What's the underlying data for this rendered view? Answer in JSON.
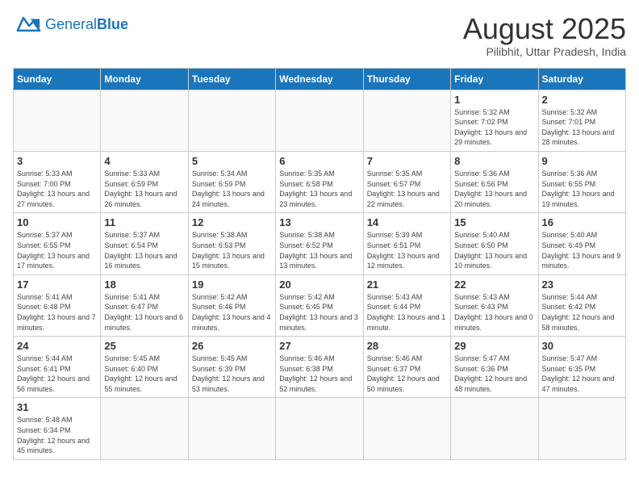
{
  "logo": {
    "text_general": "General",
    "text_blue": "Blue"
  },
  "calendar": {
    "title": "August 2025",
    "subtitle": "Pilibhit, Uttar Pradesh, India",
    "days_of_week": [
      "Sunday",
      "Monday",
      "Tuesday",
      "Wednesday",
      "Thursday",
      "Friday",
      "Saturday"
    ],
    "weeks": [
      [
        {
          "day": "",
          "info": ""
        },
        {
          "day": "",
          "info": ""
        },
        {
          "day": "",
          "info": ""
        },
        {
          "day": "",
          "info": ""
        },
        {
          "day": "",
          "info": ""
        },
        {
          "day": "1",
          "info": "Sunrise: 5:32 AM\nSunset: 7:02 PM\nDaylight: 13 hours and 29 minutes."
        },
        {
          "day": "2",
          "info": "Sunrise: 5:32 AM\nSunset: 7:01 PM\nDaylight: 13 hours and 28 minutes."
        }
      ],
      [
        {
          "day": "3",
          "info": "Sunrise: 5:33 AM\nSunset: 7:00 PM\nDaylight: 13 hours and 27 minutes."
        },
        {
          "day": "4",
          "info": "Sunrise: 5:33 AM\nSunset: 6:59 PM\nDaylight: 13 hours and 26 minutes."
        },
        {
          "day": "5",
          "info": "Sunrise: 5:34 AM\nSunset: 6:59 PM\nDaylight: 13 hours and 24 minutes."
        },
        {
          "day": "6",
          "info": "Sunrise: 5:35 AM\nSunset: 6:58 PM\nDaylight: 13 hours and 23 minutes."
        },
        {
          "day": "7",
          "info": "Sunrise: 5:35 AM\nSunset: 6:57 PM\nDaylight: 13 hours and 22 minutes."
        },
        {
          "day": "8",
          "info": "Sunrise: 5:36 AM\nSunset: 6:56 PM\nDaylight: 13 hours and 20 minutes."
        },
        {
          "day": "9",
          "info": "Sunrise: 5:36 AM\nSunset: 6:55 PM\nDaylight: 13 hours and 19 minutes."
        }
      ],
      [
        {
          "day": "10",
          "info": "Sunrise: 5:37 AM\nSunset: 6:55 PM\nDaylight: 13 hours and 17 minutes."
        },
        {
          "day": "11",
          "info": "Sunrise: 5:37 AM\nSunset: 6:54 PM\nDaylight: 13 hours and 16 minutes."
        },
        {
          "day": "12",
          "info": "Sunrise: 5:38 AM\nSunset: 6:53 PM\nDaylight: 13 hours and 15 minutes."
        },
        {
          "day": "13",
          "info": "Sunrise: 5:38 AM\nSunset: 6:52 PM\nDaylight: 13 hours and 13 minutes."
        },
        {
          "day": "14",
          "info": "Sunrise: 5:39 AM\nSunset: 6:51 PM\nDaylight: 13 hours and 12 minutes."
        },
        {
          "day": "15",
          "info": "Sunrise: 5:40 AM\nSunset: 6:50 PM\nDaylight: 13 hours and 10 minutes."
        },
        {
          "day": "16",
          "info": "Sunrise: 5:40 AM\nSunset: 6:49 PM\nDaylight: 13 hours and 9 minutes."
        }
      ],
      [
        {
          "day": "17",
          "info": "Sunrise: 5:41 AM\nSunset: 6:48 PM\nDaylight: 13 hours and 7 minutes."
        },
        {
          "day": "18",
          "info": "Sunrise: 5:41 AM\nSunset: 6:47 PM\nDaylight: 13 hours and 6 minutes."
        },
        {
          "day": "19",
          "info": "Sunrise: 5:42 AM\nSunset: 6:46 PM\nDaylight: 13 hours and 4 minutes."
        },
        {
          "day": "20",
          "info": "Sunrise: 5:42 AM\nSunset: 6:45 PM\nDaylight: 13 hours and 3 minutes."
        },
        {
          "day": "21",
          "info": "Sunrise: 5:43 AM\nSunset: 6:44 PM\nDaylight: 13 hours and 1 minute."
        },
        {
          "day": "22",
          "info": "Sunrise: 5:43 AM\nSunset: 6:43 PM\nDaylight: 13 hours and 0 minutes."
        },
        {
          "day": "23",
          "info": "Sunrise: 5:44 AM\nSunset: 6:42 PM\nDaylight: 12 hours and 58 minutes."
        }
      ],
      [
        {
          "day": "24",
          "info": "Sunrise: 5:44 AM\nSunset: 6:41 PM\nDaylight: 12 hours and 56 minutes."
        },
        {
          "day": "25",
          "info": "Sunrise: 5:45 AM\nSunset: 6:40 PM\nDaylight: 12 hours and 55 minutes."
        },
        {
          "day": "26",
          "info": "Sunrise: 5:45 AM\nSunset: 6:39 PM\nDaylight: 12 hours and 53 minutes."
        },
        {
          "day": "27",
          "info": "Sunrise: 5:46 AM\nSunset: 6:38 PM\nDaylight: 12 hours and 52 minutes."
        },
        {
          "day": "28",
          "info": "Sunrise: 5:46 AM\nSunset: 6:37 PM\nDaylight: 12 hours and 50 minutes."
        },
        {
          "day": "29",
          "info": "Sunrise: 5:47 AM\nSunset: 6:36 PM\nDaylight: 12 hours and 48 minutes."
        },
        {
          "day": "30",
          "info": "Sunrise: 5:47 AM\nSunset: 6:35 PM\nDaylight: 12 hours and 47 minutes."
        }
      ],
      [
        {
          "day": "31",
          "info": "Sunrise: 5:48 AM\nSunset: 6:34 PM\nDaylight: 12 hours and 45 minutes."
        },
        {
          "day": "",
          "info": ""
        },
        {
          "day": "",
          "info": ""
        },
        {
          "day": "",
          "info": ""
        },
        {
          "day": "",
          "info": ""
        },
        {
          "day": "",
          "info": ""
        },
        {
          "day": "",
          "info": ""
        }
      ]
    ]
  }
}
